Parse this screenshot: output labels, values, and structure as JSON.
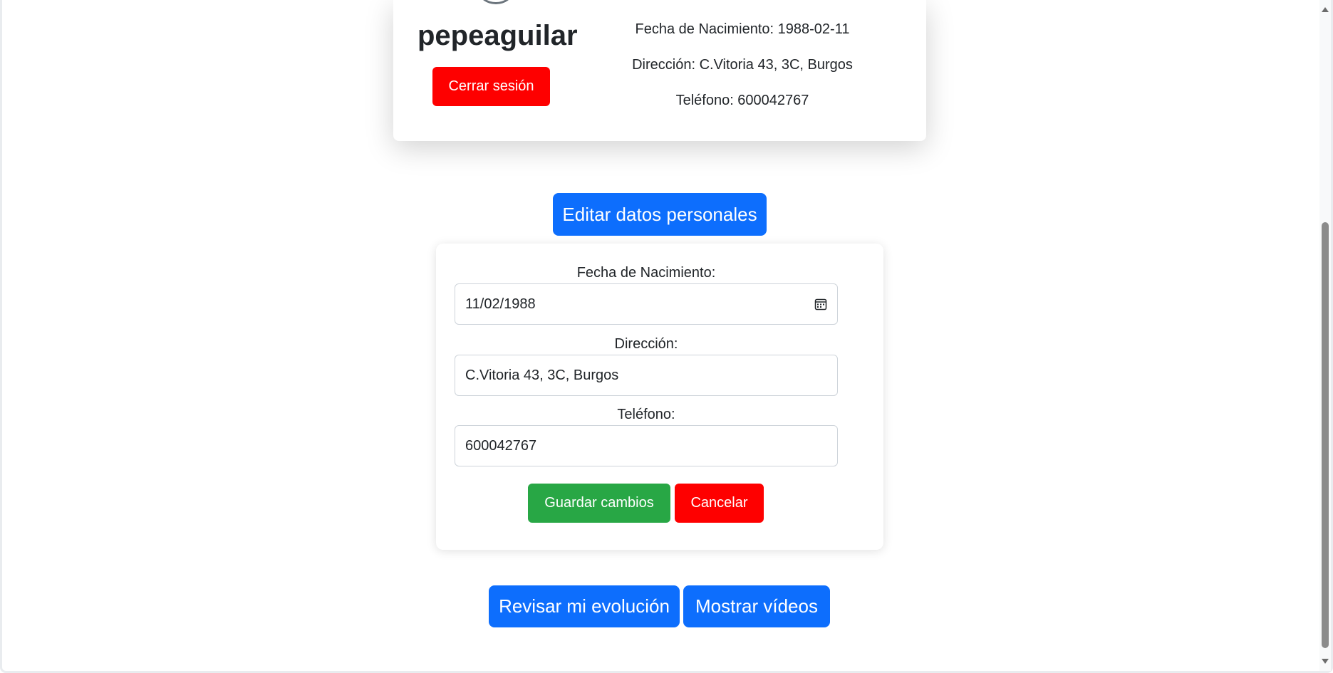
{
  "profile": {
    "username": "pepeaguilar",
    "logout_label": "Cerrar sesión",
    "birth_line": "Fecha de Nacimiento: 1988-02-11",
    "address_line": "Dirección: C.Vitoria 43, 3C, Burgos",
    "phone_line": "Teléfono: 600042767"
  },
  "edit_button_label": "Editar datos personales",
  "form": {
    "birth_label": "Fecha de Nacimiento:",
    "birth_value": "11/02/1988",
    "address_label": "Dirección:",
    "address_value": "C.Vitoria 43, 3C, Burgos",
    "phone_label": "Teléfono:",
    "phone_value": "600042767",
    "save_label": "Guardar cambios",
    "cancel_label": "Cancelar"
  },
  "actions": {
    "evolution_label": "Revisar mi evolución",
    "videos_label": "Mostrar vídeos"
  },
  "colors": {
    "primary": "#0d6efd",
    "danger": "#fe0000",
    "success": "#28a745"
  },
  "icons": {
    "date": "calendar-icon"
  }
}
